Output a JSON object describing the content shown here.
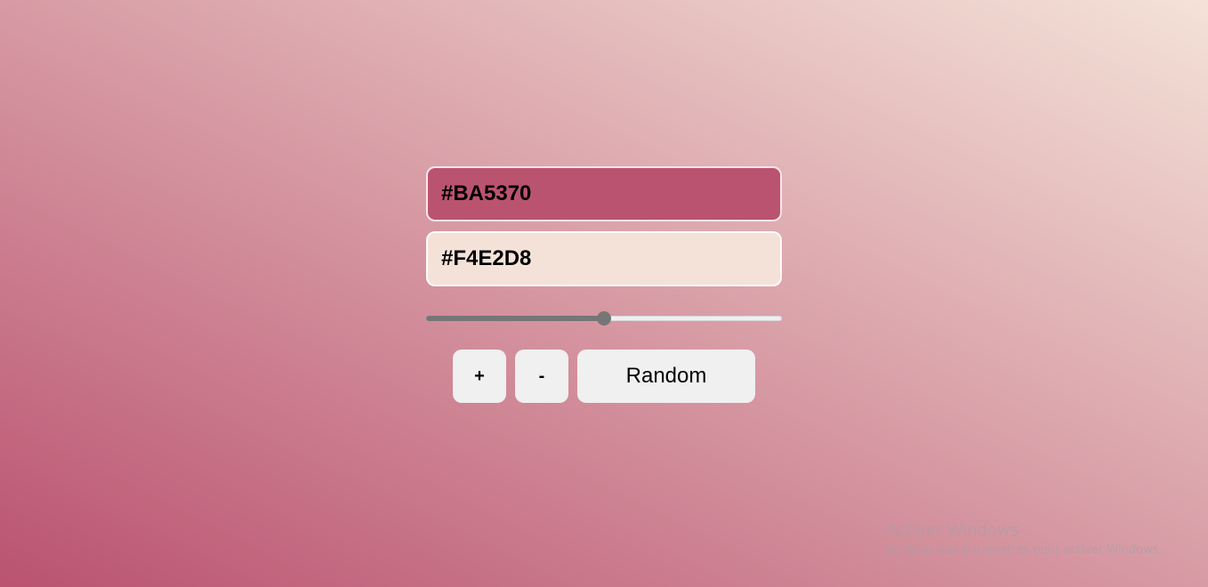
{
  "colors": {
    "color1": "#BA5370",
    "color2": "#F4E2D8"
  },
  "slider": {
    "value": 50,
    "min": 0,
    "max": 100
  },
  "buttons": {
    "plus_label": "+",
    "minus_label": "-",
    "random_label": "Random"
  },
  "watermark": {
    "title": "Activer Windows",
    "subtitle": "Accédez aux paramètres pour activer Windows."
  }
}
